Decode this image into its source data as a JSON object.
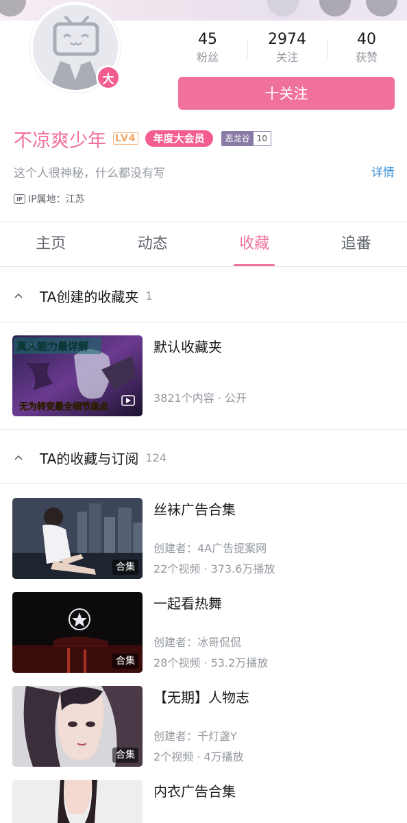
{
  "profile": {
    "level_badge": "大",
    "stats": [
      {
        "value": "45",
        "label": "粉丝"
      },
      {
        "value": "2974",
        "label": "关注"
      },
      {
        "value": "40",
        "label": "获赞"
      }
    ],
    "follow_label": "十关注",
    "username": "不凉爽少年",
    "user_level": "LV4",
    "vip_label": "年度大会员",
    "medal_name": "恶龙谷",
    "medal_level": "10",
    "bio": "这个人很神秘，什么都没有写",
    "detail_link": "详情",
    "ip_icon": "IP",
    "ip_location": "IP属地：江苏"
  },
  "tabs": [
    {
      "label": "主页",
      "active": false
    },
    {
      "label": "动态",
      "active": false
    },
    {
      "label": "收藏",
      "active": true
    },
    {
      "label": "追番",
      "active": false
    }
  ],
  "created_section": {
    "title": "TA创建的收藏夹",
    "count": "1",
    "items": [
      {
        "title": "默认收藏夹",
        "meta": "3821个内容 · 公开",
        "thumb_text_top": "真人能力最详解",
        "thumb_text_bottom": "无为转变最全细节盘点"
      }
    ]
  },
  "subscribed_section": {
    "title": "TA的收藏与订阅",
    "count": "124",
    "items": [
      {
        "title": "丝袜广告合集",
        "creator": "创建者：4A广告提案网",
        "stats": "22个视频 · 373.6万播放",
        "tag": "合集"
      },
      {
        "title": "一起看热舞",
        "creator": "创建者：冰哥侃侃",
        "stats": "28个视频 · 53.2万播放",
        "tag": "合集"
      },
      {
        "title": "【无期】人物志",
        "creator": "创建者：千灯盏Y",
        "stats": "2个视频 · 4万播放",
        "tag": "合集"
      },
      {
        "title": "内衣广告合集",
        "creator": "",
        "stats": "",
        "tag": ""
      }
    ]
  },
  "colors": {
    "accent_pink": "#f07199",
    "vip_pink": "#f25d8e",
    "link_blue": "#3a8fd6",
    "muted_text": "#9499a0"
  }
}
